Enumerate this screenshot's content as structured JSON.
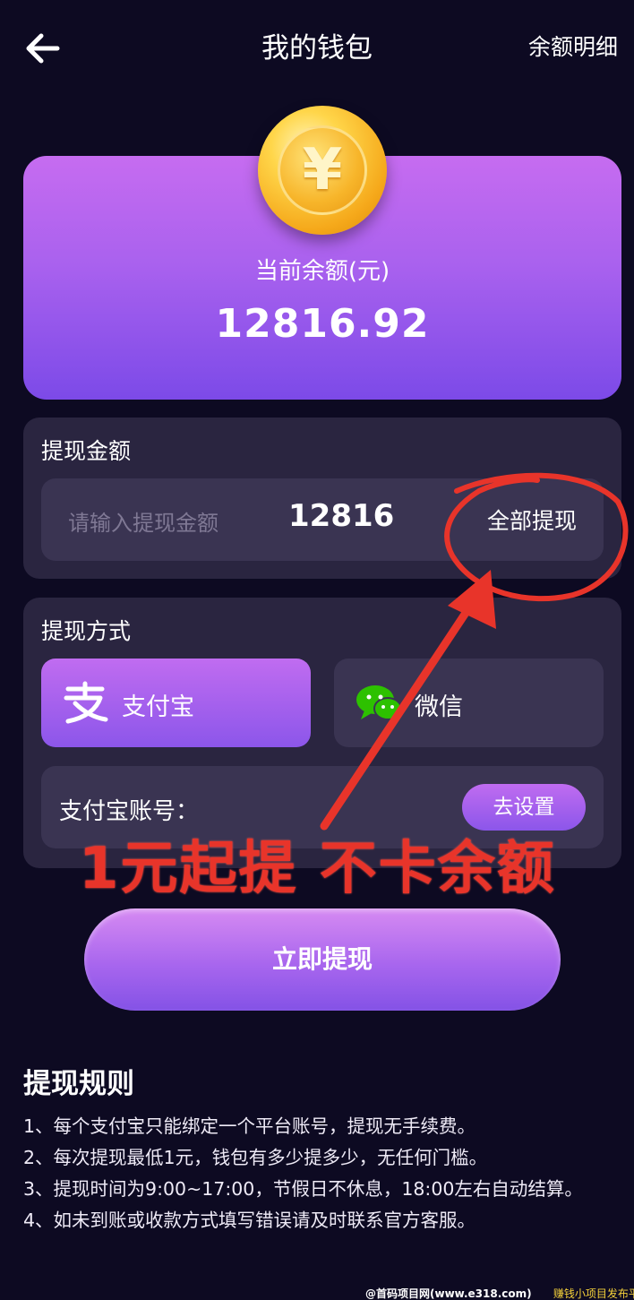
{
  "header": {
    "title": "我的钱包",
    "detail_link": "余额明细",
    "back_icon": "arrow-left-icon"
  },
  "balance": {
    "label": "当前余额(元)",
    "value": "12816.92",
    "coin_icon": "yuan-coin-icon",
    "coin_symbol": "¥"
  },
  "withdraw_amount": {
    "title": "提现金额",
    "placeholder": "请输入提现金额",
    "value": "12816",
    "withdraw_all_label": "全部提现"
  },
  "withdraw_method": {
    "title": "提现方式",
    "options": [
      {
        "label": "支付宝",
        "icon": "alipay-icon",
        "selected": true
      },
      {
        "label": "微信",
        "icon": "wechat-icon",
        "selected": false
      }
    ],
    "account_label": "支付宝账号：",
    "setup_button": "去设置"
  },
  "submit_button": "立即提现",
  "rules": {
    "title": "提现规则",
    "items": [
      "1、每个支付宝只能绑定一个平台账号，提现无手续费。",
      "2、每次提现最低1元，钱包有多少提多少，无任何门槛。",
      "3、提现时间为9:00~17:00，节假日不休息，18:00左右自动结算。",
      "4、如未到账或收款方式填写错误请及时联系官方客服。"
    ]
  },
  "annotation": {
    "promo_text": "1元起提 不卡余额",
    "color": "#e8342a"
  },
  "watermark": {
    "left": "@首码项目网(www.e318.com)",
    "right": "赚钱小项目发布平台"
  },
  "colors": {
    "background": "#0d0a22",
    "panel": "#2a2540",
    "accent": "#a961ee"
  }
}
